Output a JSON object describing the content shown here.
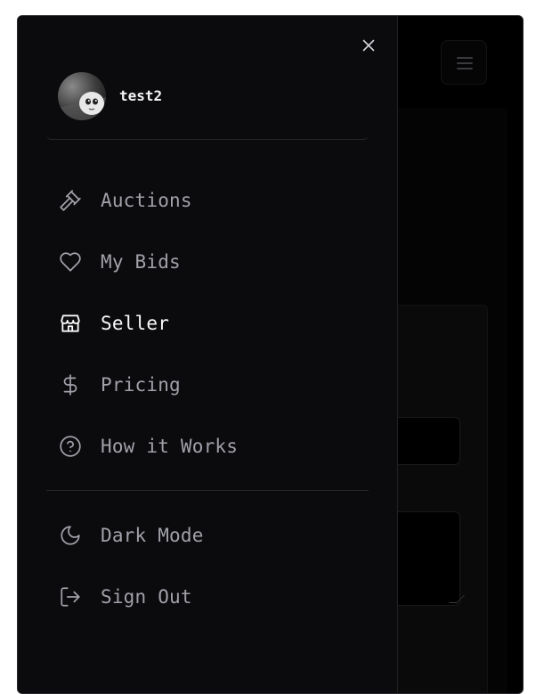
{
  "user": {
    "name": "test2"
  },
  "nav": {
    "items": [
      {
        "label": "Auctions",
        "icon": "gavel-icon",
        "active": false
      },
      {
        "label": "My Bids",
        "icon": "heart-icon",
        "active": false
      },
      {
        "label": "Seller",
        "icon": "store-icon",
        "active": true
      },
      {
        "label": "Pricing",
        "icon": "dollar-icon",
        "active": false
      },
      {
        "label": "How it Works",
        "icon": "help-circle-icon",
        "active": false
      }
    ]
  },
  "settings": {
    "items": [
      {
        "label": "Dark Mode",
        "icon": "moon-icon"
      },
      {
        "label": "Sign Out",
        "icon": "sign-out-icon"
      }
    ]
  },
  "colors": {
    "drawer_bg": "#0b0b0d",
    "page_bg": "#000000",
    "text_muted": "#a1a1aa",
    "text_active": "#fafafa",
    "divider": "#26262b"
  }
}
